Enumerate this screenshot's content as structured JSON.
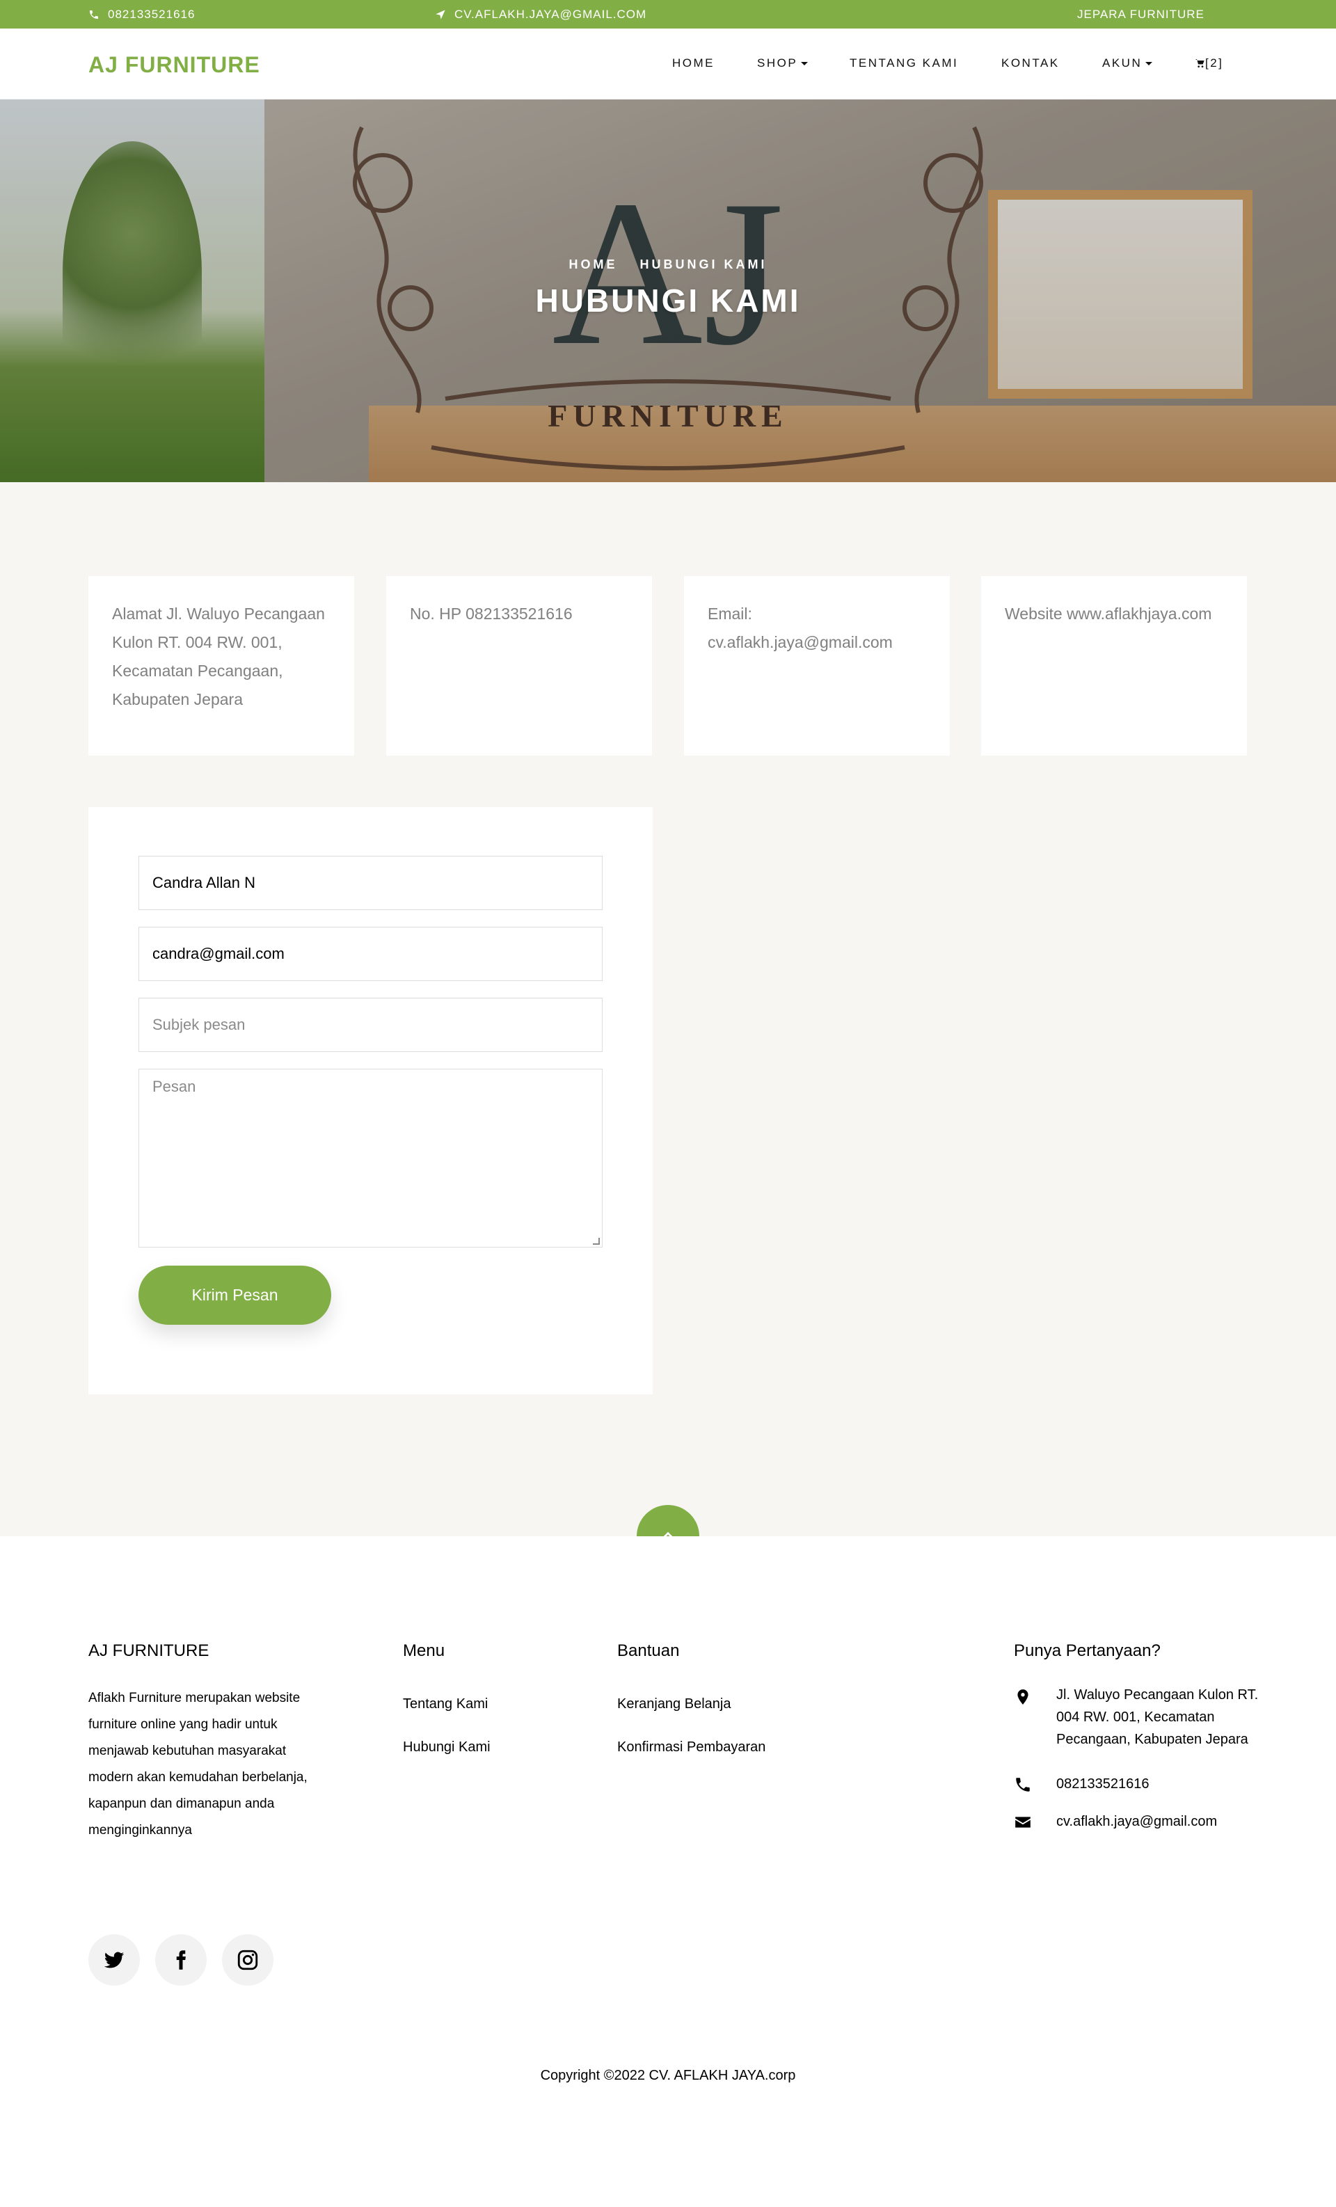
{
  "topbar": {
    "phone": "082133521616",
    "email": "CV.AFLAKH.JAYA@GMAIL.COM",
    "tagline": "JEPARA FURNITURE"
  },
  "nav": {
    "brand": "AJ FURNITURE",
    "items": [
      "HOME",
      "SHOP",
      "TENTANG KAMI",
      "KONTAK",
      "AKUN"
    ],
    "cart_count": "[2]"
  },
  "hero": {
    "breadcrumb_home": "HOME",
    "breadcrumb_current": "HUBUNGI KAMI",
    "title": "HUBUNGI KAMI",
    "logo_text": "FURNITURE"
  },
  "info_cards": [
    "Alamat Jl. Waluyo Pecangaan Kulon RT. 004 RW. 001, Kecamatan Pecangaan, Kabupaten Jepara",
    "No. HP 082133521616",
    "Email: cv.aflakh.jaya@gmail.com",
    "Website www.aflakhjaya.com"
  ],
  "form": {
    "name_value": "Candra Allan N",
    "email_value": "candra@gmail.com",
    "subject_placeholder": "Subjek pesan",
    "message_placeholder": "Pesan",
    "submit_label": "Kirim Pesan"
  },
  "footer": {
    "about_title": "AJ FURNITURE",
    "about_text": "Aflakh Furniture merupakan website furniture online yang hadir untuk menjawab kebutuhan masyarakat modern akan kemudahan berbelanja, kapanpun dan dimanapun anda menginginkannya",
    "menu_title": "Menu",
    "menu_links": [
      "Tentang Kami",
      "Hubungi Kami"
    ],
    "help_title": "Bantuan",
    "help_links": [
      "Keranjang Belanja",
      "Konfirmasi Pembayaran"
    ],
    "questions_title": "Punya Pertanyaan?",
    "address": "Jl. Waluyo Pecangaan Kulon RT. 004 RW. 001, Kecamatan Pecangaan, Kabupaten Jepara",
    "phone": "082133521616",
    "email": "cv.aflakh.jaya@gmail.com",
    "social_icons": [
      "twitter-icon",
      "facebook-icon",
      "instagram-icon"
    ],
    "copyright": "Copyright ©2022 CV. AFLAKH JAYA.corp"
  },
  "colors": {
    "accent": "#82ae46",
    "section_bg": "#f7f6f2"
  }
}
